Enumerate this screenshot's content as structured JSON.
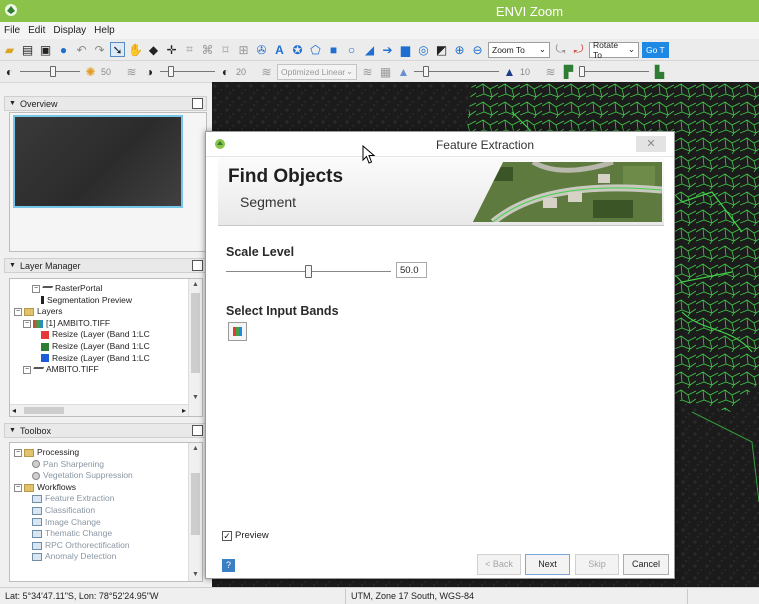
{
  "window": {
    "title": "ENVI Zoom",
    "icon": "envi-app-icon"
  },
  "menu": [
    "File",
    "Edit",
    "Display",
    "Help"
  ],
  "toolbar1": {
    "zoom_combo": "Zoom To",
    "rotate_combo": "Rotate To",
    "go_label": "Go T"
  },
  "toolbar2": {
    "brightness_value": "50",
    "contrast_value": "20",
    "stretch_combo": "Optimized Linear",
    "sharpen_value": "10"
  },
  "panels": {
    "overview": "Overview",
    "layer_manager": "Layer Manager",
    "toolbox": "Toolbox"
  },
  "layer_tree": [
    {
      "label": "RasterPortal",
      "icon": "portal-icon",
      "indent": 2,
      "exp": "−"
    },
    {
      "label": "Segmentation Preview",
      "icon": "bar-icon",
      "indent": 3
    },
    {
      "label": "Layers",
      "icon": "folder-icon",
      "indent": 0,
      "exp": "−"
    },
    {
      "label": "[1] AMBITO.TIFF",
      "icon": "layer-stack-icon",
      "indent": 1,
      "exp": "−"
    },
    {
      "label": "Resize (Layer (Band 1:LC",
      "icon": "red-band-icon",
      "indent": 3
    },
    {
      "label": "Resize (Layer (Band 1:LC",
      "icon": "green-band-icon",
      "indent": 3
    },
    {
      "label": "Resize (Layer (Band 1:LC",
      "icon": "blue-band-icon",
      "indent": 3
    },
    {
      "label": "AMBITO.TIFF",
      "icon": "portal-icon",
      "indent": 1,
      "exp": "−"
    }
  ],
  "toolbox_tree": [
    {
      "label": "Processing",
      "icon": "folder-icon",
      "indent": 0,
      "exp": "−"
    },
    {
      "label": "Pan Sharpening",
      "icon": "gear-icon",
      "indent": 2
    },
    {
      "label": "Vegetation Suppression",
      "icon": "gear-icon",
      "indent": 2
    },
    {
      "label": "Workflows",
      "icon": "folder-icon",
      "indent": 0,
      "exp": "−"
    },
    {
      "label": "Feature Extraction",
      "icon": "tool-icon",
      "indent": 2
    },
    {
      "label": "Classification",
      "icon": "tool-icon",
      "indent": 2
    },
    {
      "label": "Image Change",
      "icon": "tool-icon",
      "indent": 2
    },
    {
      "label": "Thematic Change",
      "icon": "tool-icon",
      "indent": 2
    },
    {
      "label": "RPC Orthorectification",
      "icon": "tool-icon",
      "indent": 2
    },
    {
      "label": "Anomaly Detection",
      "icon": "tool-icon",
      "indent": 2
    }
  ],
  "dialog": {
    "title": "Feature Extraction",
    "close": "✕",
    "heading": "Find Objects",
    "subheading": "Segment",
    "scale_level_label": "Scale Level",
    "scale_level_value": "50.0",
    "scale_level_fraction": 0.5,
    "select_bands_label": "Select Input Bands",
    "preview_label": "Preview",
    "preview_checked": true,
    "help": "?",
    "buttons": {
      "back": "< Back",
      "next": "Next",
      "skip": "Skip",
      "cancel": "Cancel"
    }
  },
  "status": {
    "coords": "Lat: 5°34'47.11\"S, Lon: 78°52'24.95\"W",
    "projection": "UTM, Zone 17 South, WGS-84"
  },
  "colors": {
    "titlebar": "#8bc34a",
    "segment_outline": "#43d14a",
    "overview_frame": "#76c6e8"
  }
}
